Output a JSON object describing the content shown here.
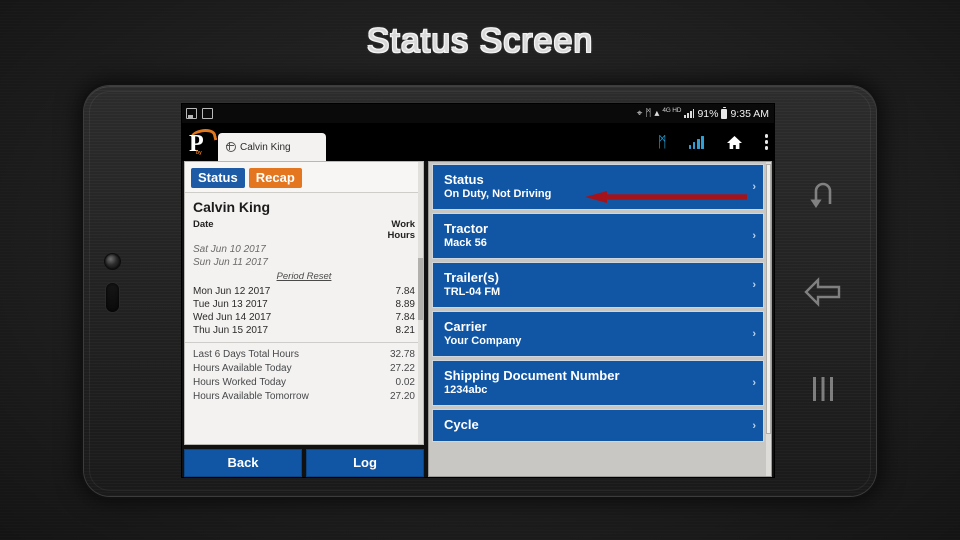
{
  "slide": {
    "title": "Status Screen"
  },
  "device": {
    "camera_icon": "front-camera-icon",
    "sensor_icon": "speaker-slot-icon"
  },
  "android_status_bar": {
    "notifications": [
      "save-notification-icon",
      "screenshot-notification-icon"
    ],
    "icons": [
      "location-icon",
      "bluetooth-icon",
      "wifi-icon",
      "network-4g-hd-icon",
      "signal-icon",
      "battery-icon"
    ],
    "location_glyph": "⌖",
    "bluetooth_glyph": "ᛗ",
    "wifi_glyph": "ᴘ",
    "network_label": "4G HD",
    "battery_percent": "91%",
    "time": "9:35 AM"
  },
  "app_toolbar": {
    "logo_letter": "P",
    "logo_sub": "by",
    "tab_label": "Calvin King",
    "tab_icon": "globe-icon",
    "actions": [
      {
        "name": "bluetooth-button",
        "glyph": "ᛗ"
      },
      {
        "name": "signal-strength-button"
      },
      {
        "name": "home-button",
        "glyph": "⌂"
      },
      {
        "name": "overflow-menu-button"
      }
    ]
  },
  "left_panel": {
    "tabs": [
      {
        "label": "Status",
        "color": "#1d5ba6",
        "active": true
      },
      {
        "label": "Recap",
        "color": "#e3761f",
        "active": false
      }
    ],
    "driver_name": "Calvin King",
    "columns": {
      "date": "Date",
      "work": "Work",
      "hours": "Hours"
    },
    "rows": [
      {
        "date": "Sat Jun 10 2017",
        "hours": "",
        "dim": true
      },
      {
        "date": "Sun Jun 11 2017",
        "hours": "",
        "dim": true
      }
    ],
    "period_reset": "Period Reset",
    "rows_after": [
      {
        "date": "Mon Jun 12 2017",
        "hours": "7.84"
      },
      {
        "date": "Tue Jun 13 2017",
        "hours": "8.89"
      },
      {
        "date": "Wed Jun 14 2017",
        "hours": "7.84"
      },
      {
        "date": "Thu Jun 15 2017",
        "hours": "8.21"
      }
    ],
    "summary": [
      {
        "label": "Last 6 Days Total Hours",
        "value": "32.78"
      },
      {
        "label": "Hours Available Today",
        "value": "27.22"
      },
      {
        "label": "Hours Worked Today",
        "value": "0.02"
      },
      {
        "label": "Hours Available Tomorrow",
        "value": "27.20"
      }
    ],
    "buttons": [
      {
        "label": "Back",
        "name": "back-button"
      },
      {
        "label": "Log",
        "name": "log-button"
      }
    ]
  },
  "right_panel": {
    "rows": [
      {
        "title": "Status",
        "value": "On Duty, Not Driving",
        "name": "row-status"
      },
      {
        "title": "Tractor",
        "value": "Mack 56",
        "name": "row-tractor"
      },
      {
        "title": "Trailer(s)",
        "value": "TRL-04 FM",
        "name": "row-trailers"
      },
      {
        "title": "Carrier",
        "value": "Your Company",
        "name": "row-carrier"
      },
      {
        "title": "Shipping Document Number",
        "value": "1234abc",
        "name": "row-shipping-document-number"
      },
      {
        "title": "Cycle",
        "value": "",
        "name": "row-cycle"
      }
    ],
    "chevron": "›",
    "annotation_arrow": {
      "color": "#a5131a",
      "direction": "left",
      "points_at": "row-status"
    }
  },
  "nav_bar": {
    "buttons": [
      {
        "name": "recents-button",
        "icon": "recents-hook-arrow-icon"
      },
      {
        "name": "back-button",
        "icon": "back-arrow-icon"
      },
      {
        "name": "menu-button",
        "icon": "three-bars-icon"
      }
    ]
  },
  "colors": {
    "row_blue": "#1156a5",
    "tab_blue": "#1d5ba6",
    "tab_orange": "#e3761f",
    "arrow_red": "#a5131a",
    "panel_bg": "#f4f2f0",
    "background": "#1d1d1d"
  }
}
